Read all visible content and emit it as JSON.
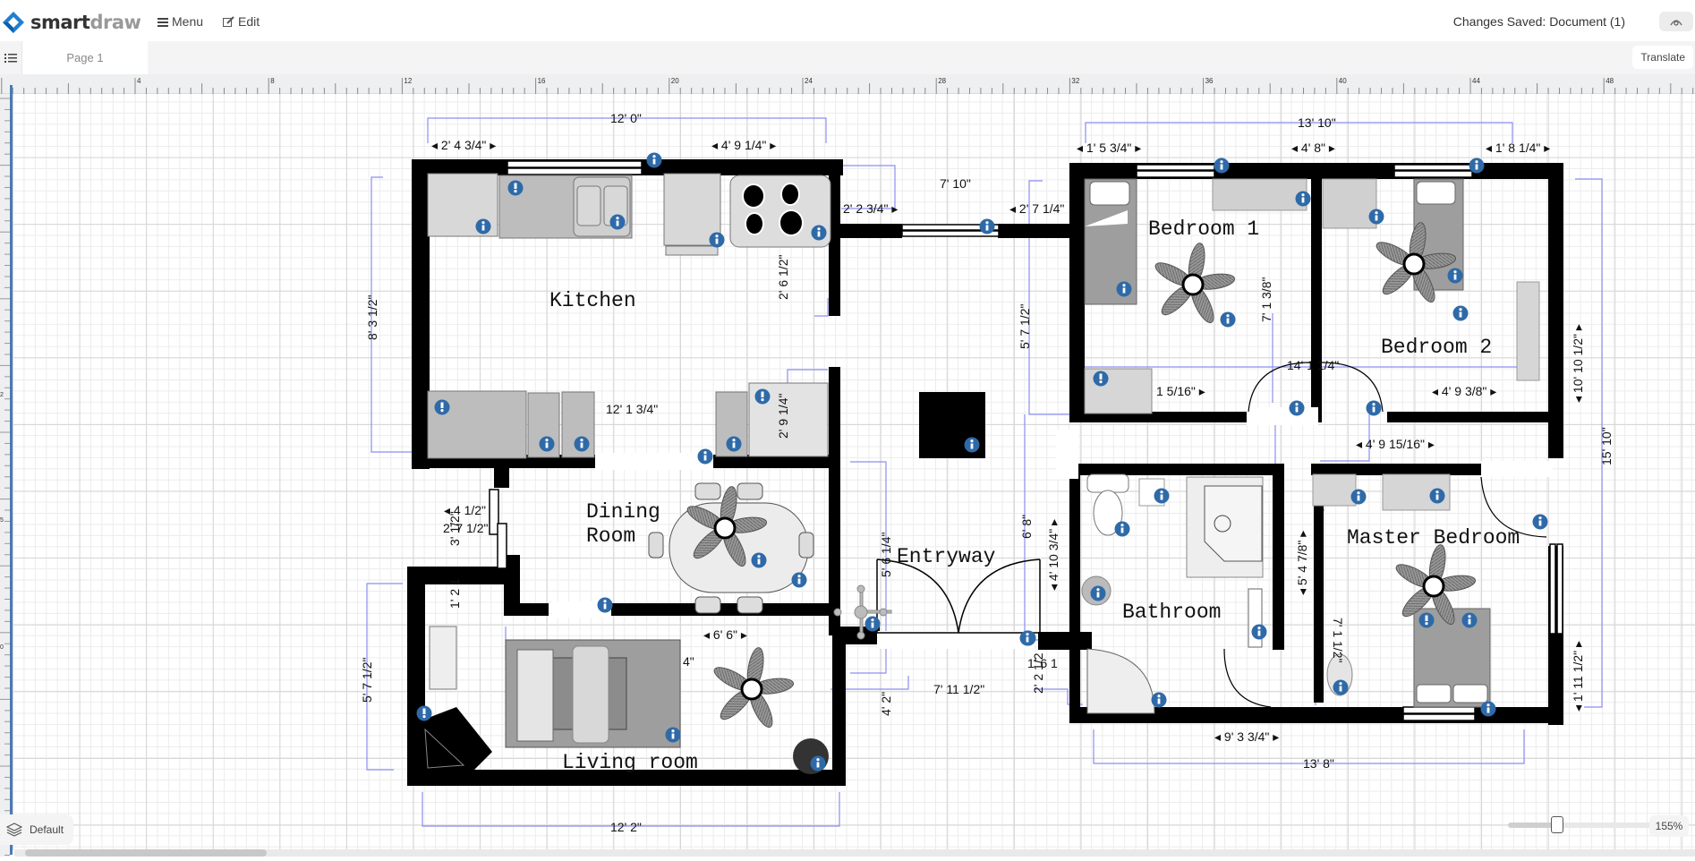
{
  "app": {
    "name_primary": "smart",
    "name_secondary": "draw",
    "menu_label": "Menu",
    "edit_label": "Edit",
    "status": "Changes Saved: Document (1)",
    "view_icon": "eye-icon"
  },
  "tabs": {
    "pages_icon": "list-icon",
    "active_page": "Page 1",
    "translate_label": "Translate"
  },
  "ruler": {
    "horizontal_labels": [
      "4",
      "8",
      "12",
      "16",
      "20",
      "24",
      "28",
      "32",
      "36",
      "40",
      "44",
      "48"
    ],
    "vertical_labels": [
      "2",
      "5",
      "0"
    ]
  },
  "floorplan": {
    "rooms": [
      {
        "name": "Kitchen"
      },
      {
        "name": "Dining"
      },
      {
        "name": "Room"
      },
      {
        "name": "Entryway"
      },
      {
        "name": "Living room"
      },
      {
        "name": "Bedroom 1"
      },
      {
        "name": "Bedroom 2"
      },
      {
        "name": "Bathroom"
      },
      {
        "name": "Master Bedroom"
      }
    ],
    "dimensions": {
      "kitchen_top_total": "12' 0\"",
      "kitchen_top_left": "◂ 2' 4 3/4\" ▸",
      "kitchen_top_right": "◂ 4' 9 1/4\" ▸",
      "kitchen_left": "8' 3 1/2\"",
      "kitchen_right_upper": "2' 6 1/2\"",
      "kitchen_right_lower": "2' 9 1/4\"",
      "kitchen_width_inner": "12' 1 3/4\"",
      "hall_top": "7' 10\"",
      "hall_left_small": "2' 2 3/4\" ▸",
      "hall_right_small": "◂ 2' 7 1/4\"",
      "hall_vertical": "5' 7 1/2\"",
      "dining_left_a": "◂ 4 1/2\"",
      "dining_left_b": "2' 7 1/2\"",
      "dining_left_c": "3' 1/2\"",
      "dining_left_d": "1' 2 1",
      "entry_left": "5' 6 1/4\"",
      "entry_right": "6' 8\"",
      "entry_door": "◂ 4' 10 3/4\" ▸",
      "living_top": "◂ 6' 6\" ▸",
      "living_rug": "4\"",
      "living_span": "7' 11 1/2\"",
      "living_left": "5' 7 1/2\"",
      "living_right": "4' 2\"",
      "living_bottom": "12' 2\"",
      "bed_top_total": "13' 10\"",
      "bed_top_left": "◂ 1' 5 3/4\" ▸",
      "bed_top_mid": "◂ 4' 8\" ▸",
      "bed_top_right": "◂ 1' 8 1/4\" ▸",
      "bed1_vertical": "7' 1 3/8\"",
      "bed1_bottom": "1 5/16\" ▸",
      "bed_mid_span": "14' 1 1/4\"",
      "bed2_bottom": "◂ 4' 9 3/8\" ▸",
      "bed2_right": "◂ 10' 10 1/2\" ▸",
      "right_total": "15' 10\"",
      "hall_between": "◂ 4' 9 15/16\" ▸",
      "bath_shower": "◂ 5' 4 7/8\" ▸",
      "master_left": "7' 1 1/2\"",
      "bath_left_a": "1' 6 1",
      "bath_left_b": "2' 2 1/2",
      "bath_bottom": "◂ 9' 3 3/4\" ▸",
      "bath_total": "13' 8\"",
      "master_right": "◂ 1' 11 1/2\" ▸"
    }
  },
  "bottom": {
    "layer_label": "Default",
    "layer_icon": "layers-icon",
    "zoom_percent": "155%",
    "zoom_fraction": 0.35
  }
}
